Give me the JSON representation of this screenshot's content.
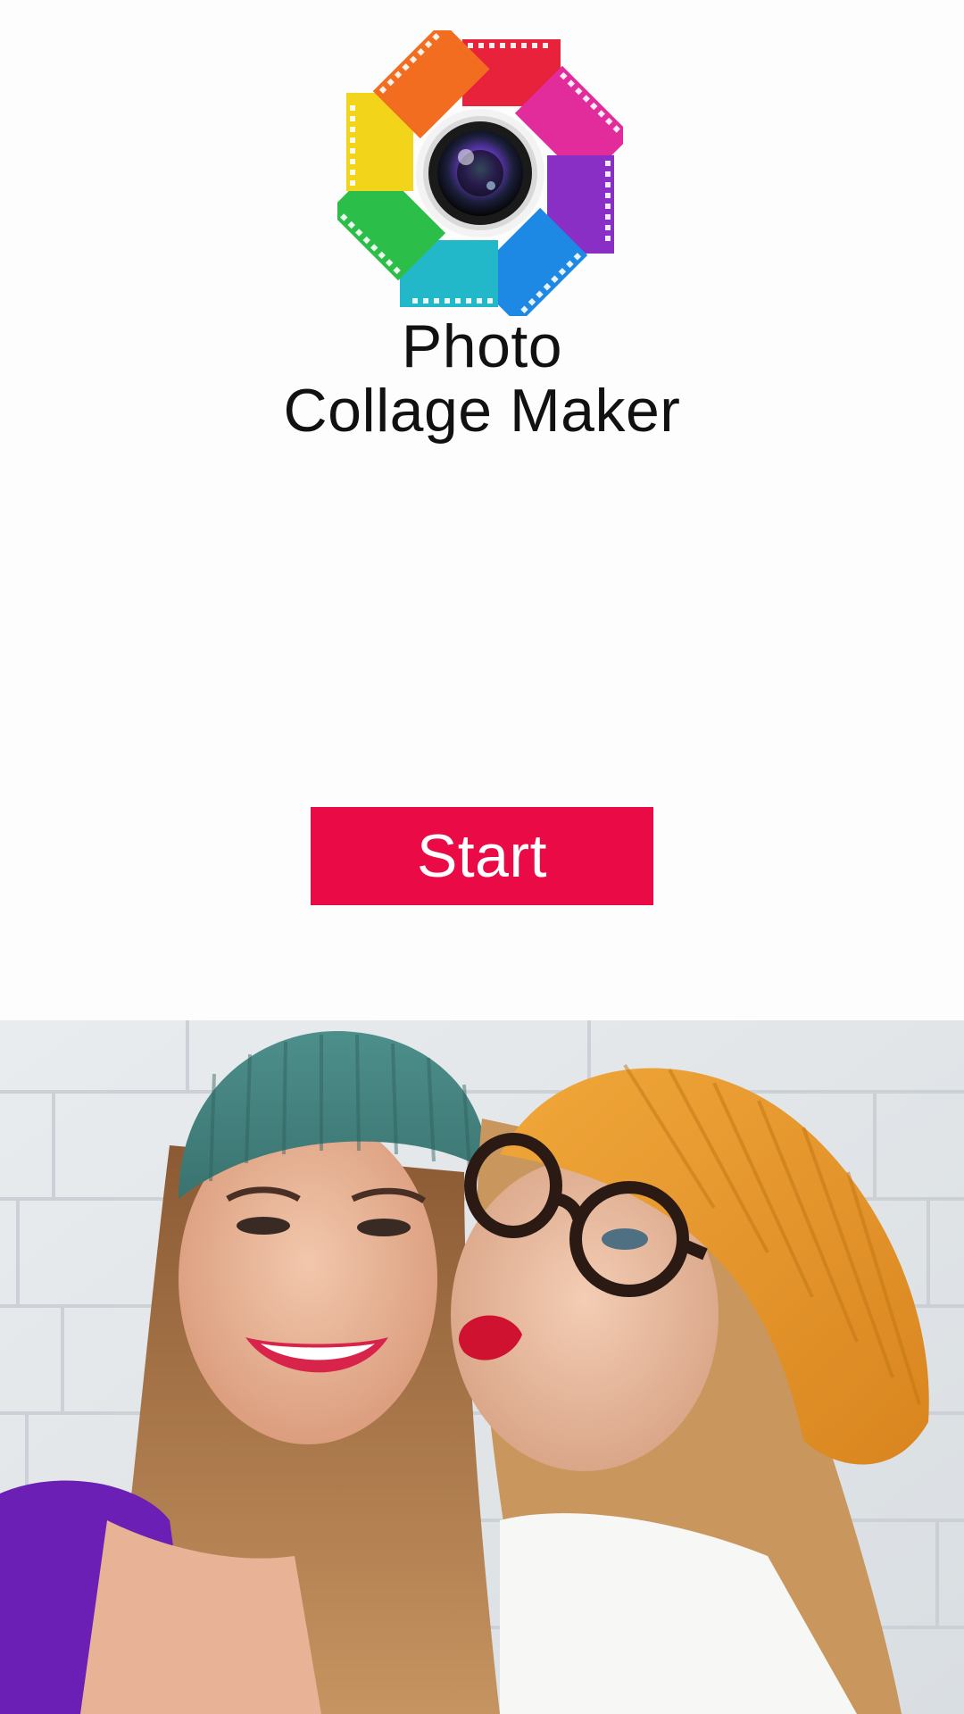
{
  "app": {
    "title_line1": "Photo",
    "title_line2": "Collage Maker"
  },
  "actions": {
    "start_label": "Start"
  },
  "colors": {
    "accent": "#e90a46",
    "background": "#fdfdfd",
    "title_text": "#111111"
  },
  "icons": {
    "logo": "camera-lens-film-pinwheel-icon"
  }
}
